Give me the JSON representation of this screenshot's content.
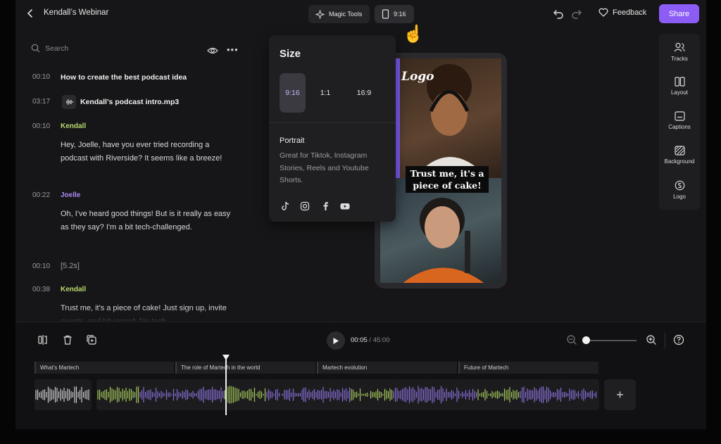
{
  "topbar": {
    "title": "Kendall’s Webinar",
    "magic_label": "Magic Tools",
    "ratio_label": "9:16",
    "feedback_label": "Feedback",
    "share_label": "Share"
  },
  "transcript": {
    "search_placeholder": "Search",
    "entries": [
      {
        "time": "00:10",
        "text": "How to create the best podcast idea"
      },
      {
        "time": "03:17",
        "text": "Kendall’s podcast intro.mp3"
      },
      {
        "time": "00:10",
        "speaker": "Kendall",
        "text": "Hey, Joelle, have you ever tried recording a podcast with Riverside? It seems like a breeze!"
      },
      {
        "time": "00:22",
        "speaker": "Joelle",
        "text": "Oh, I've heard good things! But is it really as easy as they say? I'm a bit tech-challenged."
      },
      {
        "time": "00:10",
        "text": "[5.2s]"
      },
      {
        "time": "00:38",
        "speaker": "Kendall",
        "text": "Trust me, it's a piece of cake! Just sign up, invite guests, and hit record. No tech"
      }
    ]
  },
  "size_popup": {
    "title": "Size",
    "options": [
      "9:16",
      "1:1",
      "16:9"
    ],
    "selected": "9:16",
    "format_title": "Portrait",
    "format_desc": "Great for Tiktok, Instagram Stories, Reels and Youtube Shorts.",
    "socials": [
      "tiktok-icon",
      "instagram-icon",
      "facebook-icon",
      "youtube-icon"
    ]
  },
  "preview": {
    "logo_text": "Logo",
    "caption": "Trust me, it's a piece of cake!"
  },
  "right_toolbar": [
    "Tracks",
    "Layout",
    "Captions",
    "Background",
    "Logo"
  ],
  "timeline": {
    "current": "00:05",
    "separator": "/",
    "total": "45:00",
    "chapters": [
      "What's Martech",
      "The role of Martech in the world",
      "Martech evolution",
      "Future of Martech"
    ],
    "zoom_level": 0.05
  },
  "colors": {
    "accent": "#8b5cf6",
    "kendall": "#b9d86b",
    "joelle": "#a98af5",
    "wave_green": "#a4c85a",
    "wave_purple": "#8a6fd9"
  }
}
